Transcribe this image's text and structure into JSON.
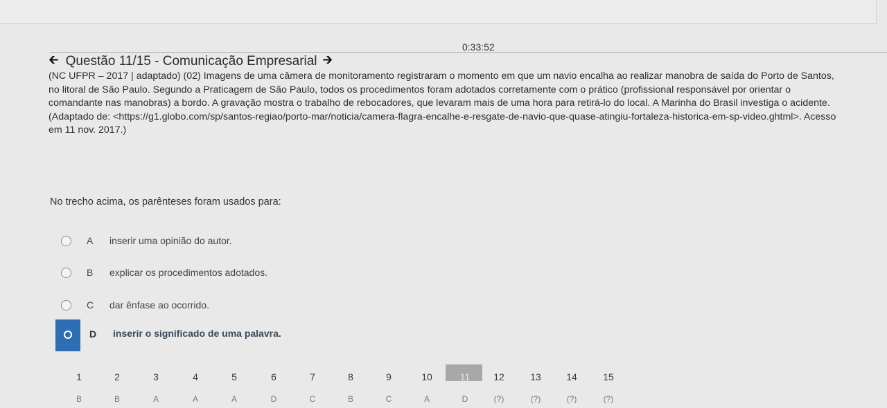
{
  "timer": "0:33:52",
  "header": {
    "title": "Questão 11/15 - Comunicação Empresarial"
  },
  "question": {
    "lines": [
      "(NC UFPR – 2017 | adaptado) (02) Imagens de uma câmera de monitoramento registraram o momento em que um navio encalha ao realizar manobra de saída do Porto de Santos,",
      "no litoral de São Paulo. Segundo a Praticagem de São Paulo, todos os procedimentos foram adotados corretamente com o prático (profissional responsável por orientar o",
      "comandante nas manobras) a bordo. A gravação mostra o trabalho de rebocadores, que levaram mais de uma hora para retirá-lo do local. A Marinha do Brasil investiga o acidente.",
      "(Adaptado de: <https://g1.globo.com/sp/santos-regiao/porto-mar/noticia/camera-flagra-encalhe-e-resgate-de-navio-que-quase-atingiu-fortaleza-historica-em-sp-video.ghtml>. Acesso",
      "em 11 nov. 2017.)"
    ],
    "prompt": "No trecho acima, os parênteses foram usados para:"
  },
  "options": [
    {
      "letter": "A",
      "text": "inserir uma opinião do autor."
    },
    {
      "letter": "B",
      "text": "explicar os procedimentos adotados."
    },
    {
      "letter": "C",
      "text": "dar ênfase ao ocorrido."
    },
    {
      "letter": "D",
      "text": "inserir o significado de uma palavra."
    }
  ],
  "selected_option": "D",
  "navigation": [
    {
      "num": "1",
      "ans": "B"
    },
    {
      "num": "2",
      "ans": "B"
    },
    {
      "num": "3",
      "ans": "A"
    },
    {
      "num": "4",
      "ans": "A"
    },
    {
      "num": "5",
      "ans": "A"
    },
    {
      "num": "6",
      "ans": "D"
    },
    {
      "num": "7",
      "ans": "C"
    },
    {
      "num": "8",
      "ans": "B"
    },
    {
      "num": "9",
      "ans": "C"
    },
    {
      "num": "10",
      "ans": "A"
    },
    {
      "num": "11",
      "ans": "D"
    },
    {
      "num": "12",
      "ans": "(?)"
    },
    {
      "num": "13",
      "ans": "(?)"
    },
    {
      "num": "14",
      "ans": "(?)"
    },
    {
      "num": "15",
      "ans": "(?)"
    }
  ],
  "current_question": "11",
  "icons": {
    "prev": "arrow-left-icon",
    "next": "arrow-right-icon"
  },
  "colors": {
    "selected": "#2f6eb3",
    "current_nav": "#a8a8a8"
  }
}
